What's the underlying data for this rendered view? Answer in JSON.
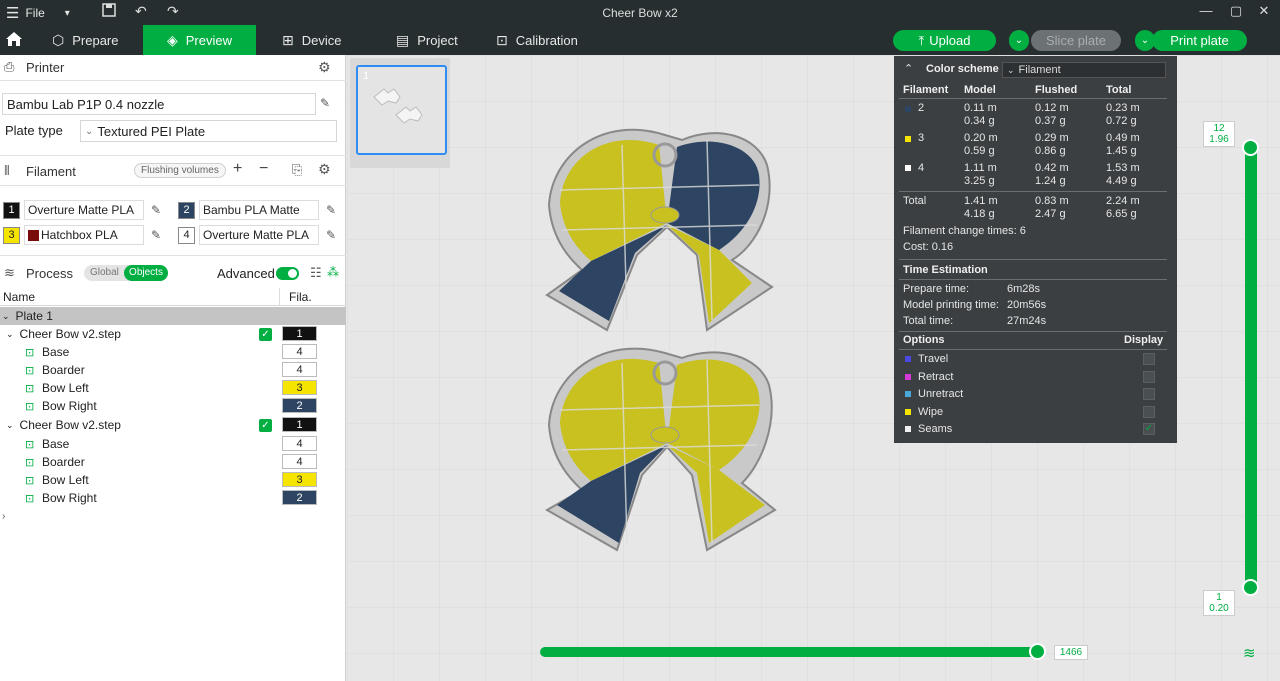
{
  "window": {
    "title": "Cheer Bow x2",
    "file_menu": "File"
  },
  "nav": {
    "tabs": [
      {
        "label": "Prepare"
      },
      {
        "label": "Preview"
      },
      {
        "label": "Device"
      },
      {
        "label": "Project"
      },
      {
        "label": "Calibration"
      }
    ],
    "upload": "Upload",
    "slice_plate": "Slice plate",
    "print_plate": "Print plate"
  },
  "printer": {
    "section": "Printer",
    "name": "Bambu Lab P1P 0.4 nozzle",
    "plate_type_label": "Plate type",
    "plate_type": "Textured PEI Plate"
  },
  "filament": {
    "section": "Filament",
    "flushing": "Flushing volumes",
    "items": [
      {
        "num": "1",
        "name": "Overture Matte PLA",
        "color": "#111111",
        "text": "#ffffff"
      },
      {
        "num": "2",
        "name": "Bambu PLA Matte",
        "color": "#2d4463",
        "text": "#ffffff"
      },
      {
        "num": "3",
        "name": "Hatchbox PLA",
        "color": "#f5e400",
        "text": "#222222",
        "swatch": "#7a0c0c"
      },
      {
        "num": "4",
        "name": "Overture Matte PLA",
        "color": "#ffffff",
        "text": "#222222"
      }
    ]
  },
  "process": {
    "section": "Process",
    "global": "Global",
    "objects": "Objects",
    "advanced": "Advanced"
  },
  "tree": {
    "col_name": "Name",
    "col_fila": "Fila.",
    "plate": "Plate 1",
    "objects": [
      {
        "name": "Cheer Bow v2.step",
        "fila": "1",
        "parts": [
          {
            "name": "Base",
            "fila": "4"
          },
          {
            "name": "Boarder",
            "fila": "4"
          },
          {
            "name": "Bow Left",
            "fila": "3"
          },
          {
            "name": "Bow Right",
            "fila": "2"
          }
        ]
      },
      {
        "name": "Cheer Bow v2.step",
        "fila": "1",
        "parts": [
          {
            "name": "Base",
            "fila": "4"
          },
          {
            "name": "Boarder",
            "fila": "4"
          },
          {
            "name": "Bow Left",
            "fila": "3"
          },
          {
            "name": "Bow Right",
            "fila": "2"
          }
        ]
      }
    ]
  },
  "thumbnail": {
    "label": "1"
  },
  "stats": {
    "color_scheme_label": "Color scheme",
    "color_scheme": "Filament",
    "headers": [
      "Filament",
      "Model",
      "Flushed",
      "Total"
    ],
    "rows": [
      {
        "fil": "2",
        "color": "#2d4463",
        "model_m": "0.11 m",
        "model_g": "0.34 g",
        "flushed_m": "0.12 m",
        "flushed_g": "0.37 g",
        "total_m": "0.23 m",
        "total_g": "0.72 g"
      },
      {
        "fil": "3",
        "color": "#f5e400",
        "model_m": "0.20 m",
        "model_g": "0.59 g",
        "flushed_m": "0.29 m",
        "flushed_g": "0.86 g",
        "total_m": "0.49 m",
        "total_g": "1.45 g"
      },
      {
        "fil": "4",
        "color": "#ffffff",
        "model_m": "1.11 m",
        "model_g": "3.25 g",
        "flushed_m": "0.42 m",
        "flushed_g": "1.24 g",
        "total_m": "1.53 m",
        "total_g": "4.49 g"
      }
    ],
    "total": {
      "label": "Total",
      "model_m": "1.41 m",
      "model_g": "4.18 g",
      "flushed_m": "0.83 m",
      "flushed_g": "2.47 g",
      "total_m": "2.24 m",
      "total_g": "6.65 g"
    },
    "change_times": "Filament change times:  6",
    "cost": "Cost:  0.16",
    "time_header": "Time Estimation",
    "prepare_label": "Prepare time:",
    "prepare": "6m28s",
    "model_time_label": "Model printing time:",
    "model_time": "20m56s",
    "total_time_label": "Total time:",
    "total_time": "27m24s",
    "options_header": "Options",
    "display_header": "Display",
    "options": [
      {
        "label": "Travel",
        "color": "#4a4ae0"
      },
      {
        "label": "Retract",
        "color": "#d63ad6"
      },
      {
        "label": "Unretract",
        "color": "#4aa8d8"
      },
      {
        "label": "Wipe",
        "color": "#f5e400"
      },
      {
        "label": "Seams",
        "color": "#f0f0f0"
      }
    ]
  },
  "layers": {
    "top_layer": "12",
    "top_height": "1.96",
    "bottom_layer": "1",
    "bottom_height": "0.20",
    "move": "1466"
  },
  "colors": {
    "accent": "#00ae42",
    "navy": "#2d4463",
    "yellow": "#c9c21a"
  }
}
